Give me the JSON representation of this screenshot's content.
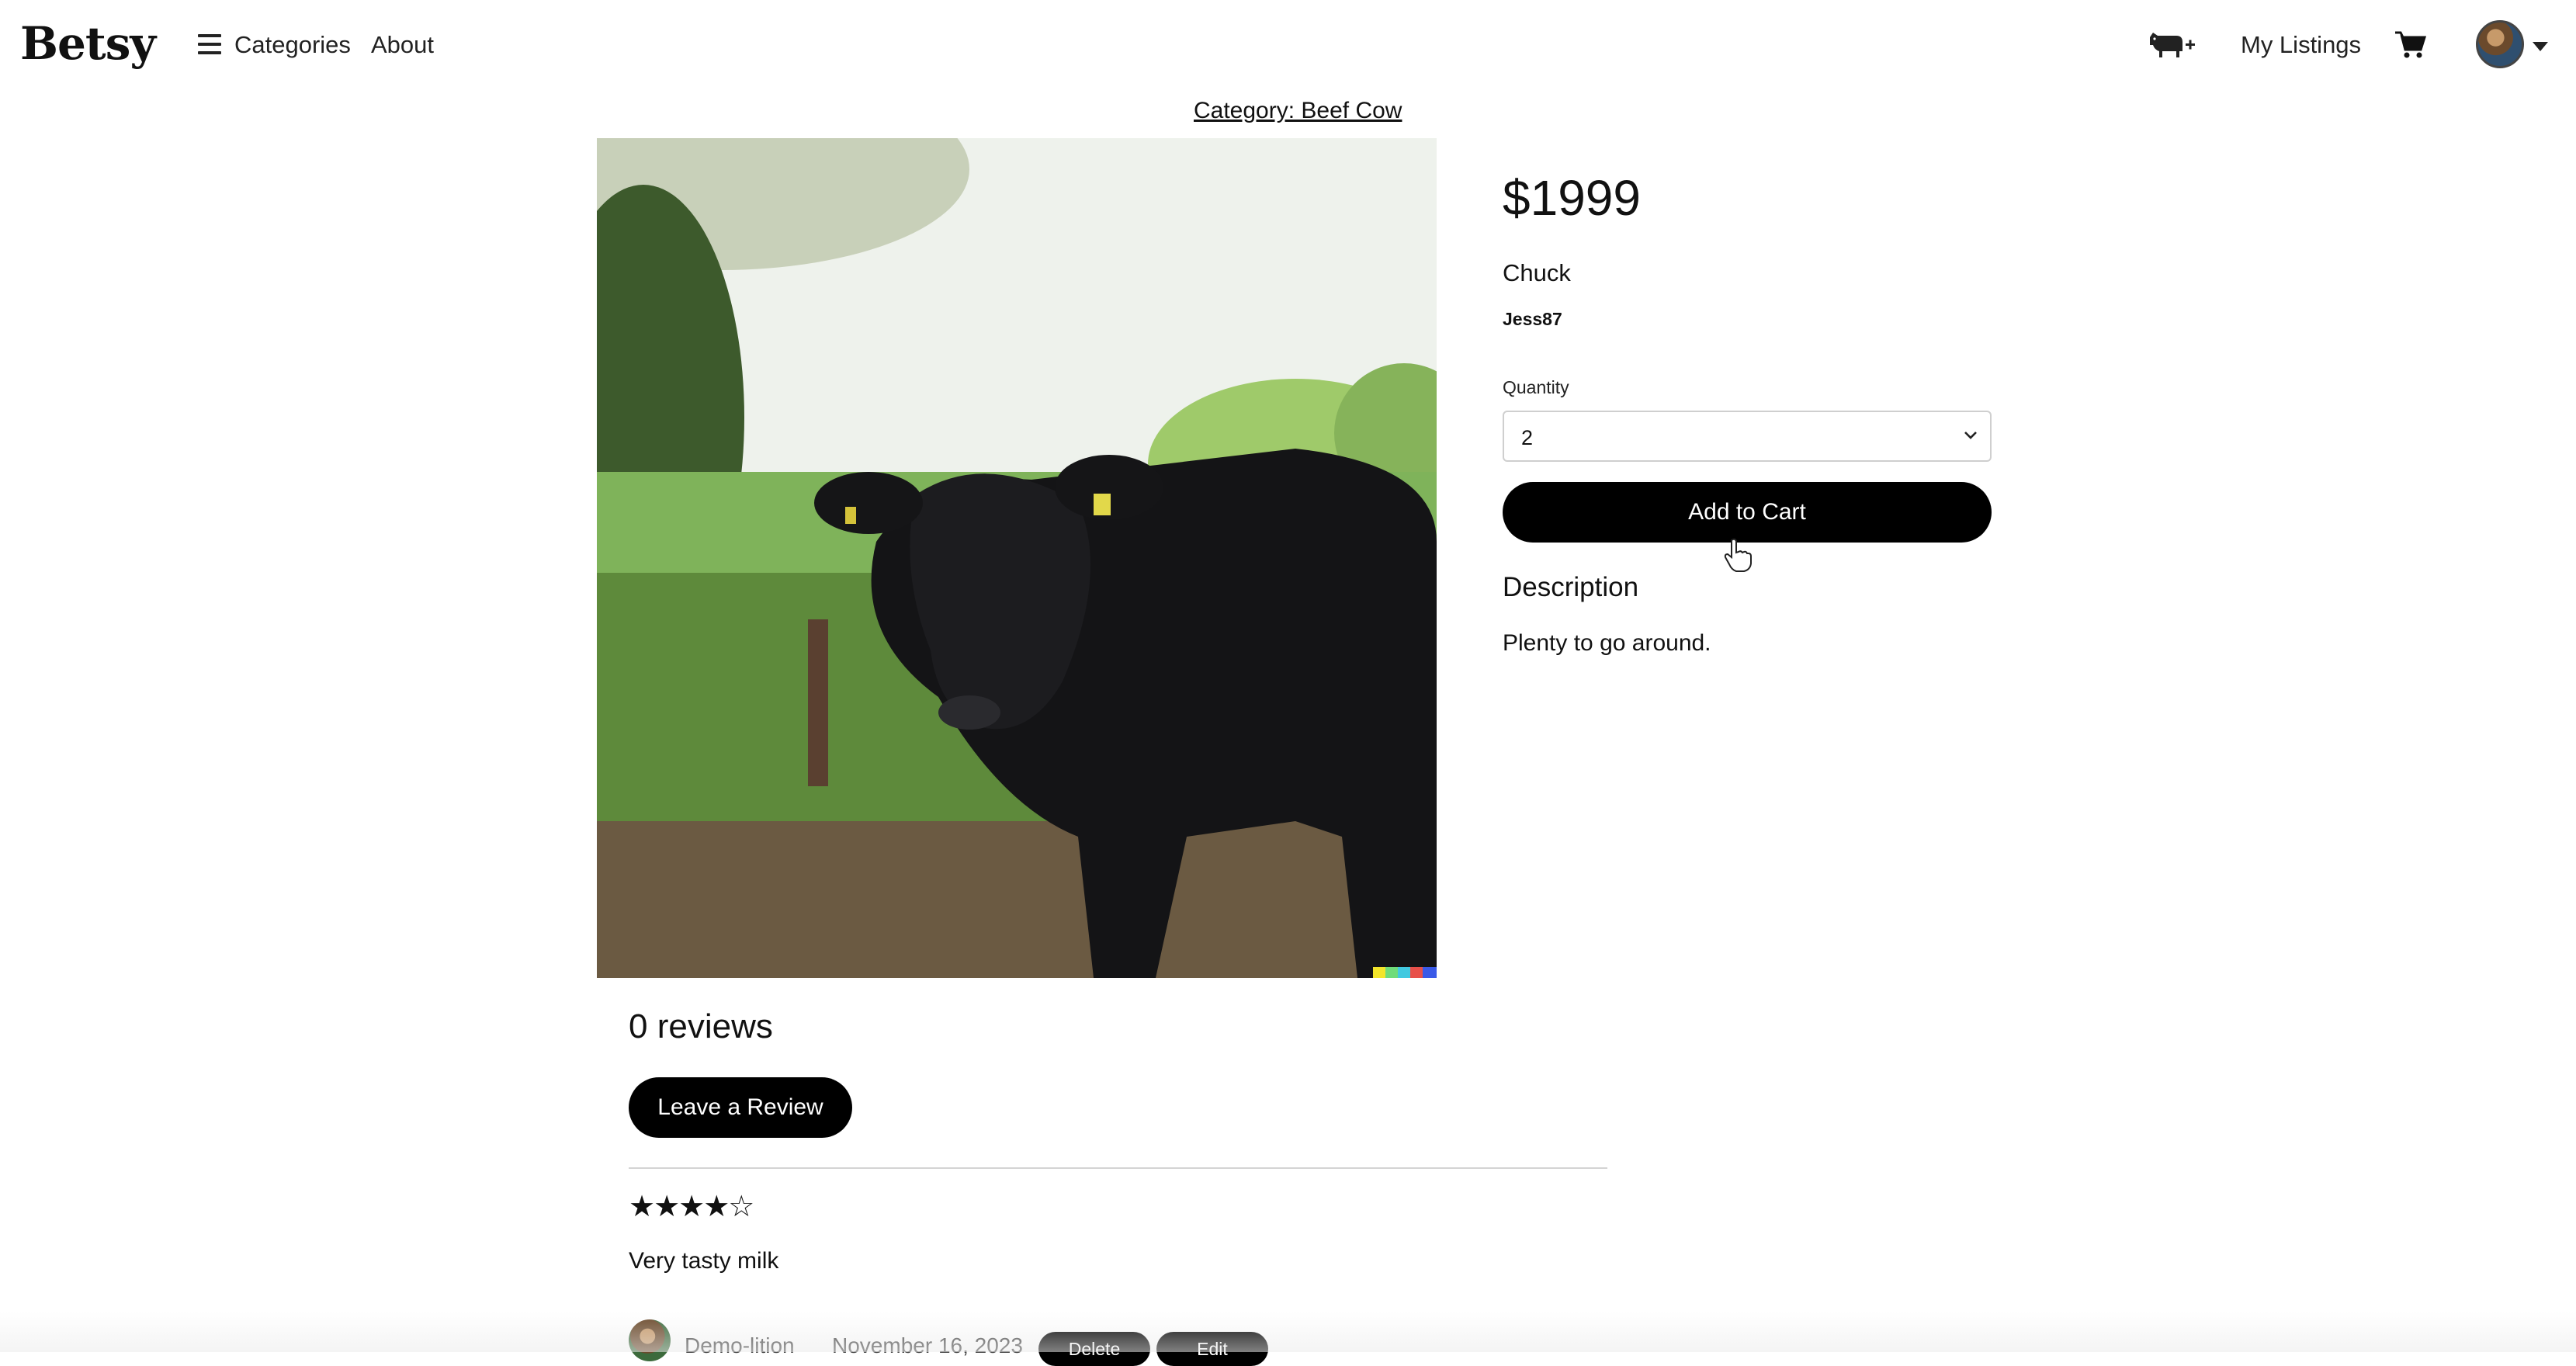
{
  "header": {
    "logo": "Betsy",
    "nav": {
      "categories": "Categories",
      "about": "About",
      "my_listings": "My Listings"
    },
    "icons": {
      "menu": "hamburger-icon",
      "add_listing": "cow-plus-icon",
      "cart": "cart-icon",
      "profile": "avatar"
    }
  },
  "product": {
    "category": "Category: Beef Cow",
    "image": "black-cow-photo",
    "price": "$1999",
    "name": "Chuck",
    "seller": "Jess87",
    "quantity": {
      "label": "Quantity",
      "value": "2"
    },
    "add_to_cart": "Add to Cart",
    "description": {
      "heading": "Description",
      "text": "Plenty to go around."
    }
  },
  "reviews": {
    "count_text": "0 reviews",
    "leave_review": "Leave a Review",
    "items": [
      {
        "stars": "★★★★☆",
        "rating": 4,
        "text": "Very tasty milk",
        "author": "Demo-lition",
        "date": "November 16, 2023",
        "delete": "Delete",
        "edit": "Edit"
      }
    ]
  },
  "colors": {
    "primary_button": "#000000",
    "text": "#111111",
    "divider": "#d4d4d4"
  }
}
